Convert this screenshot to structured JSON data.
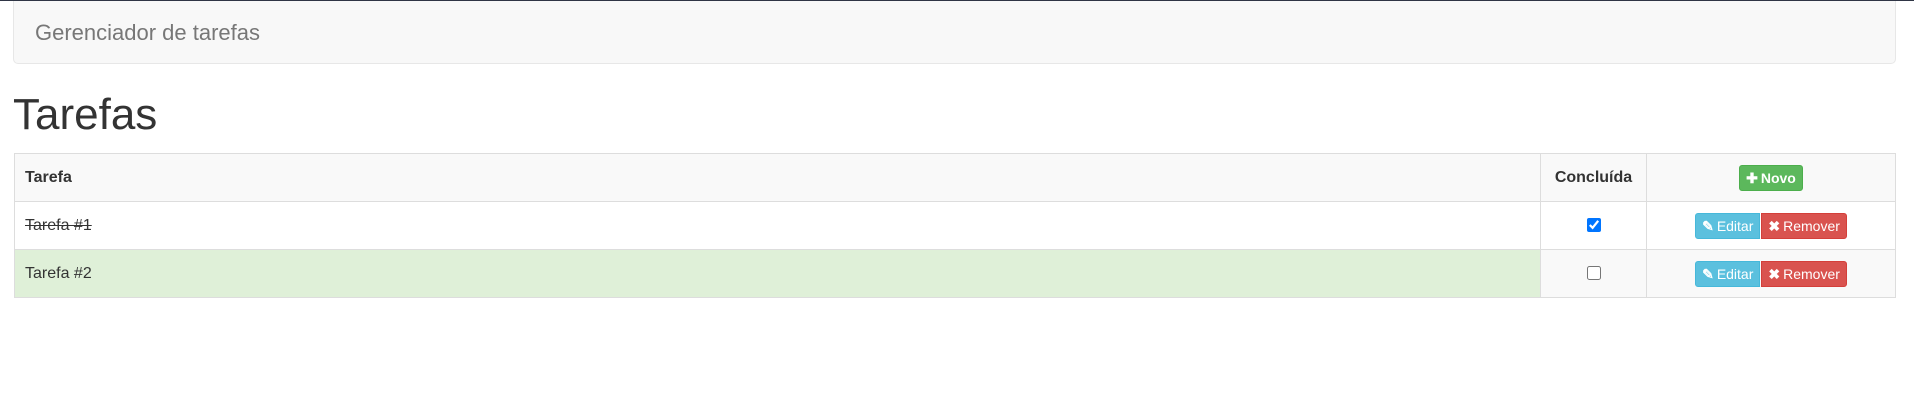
{
  "navbar": {
    "brand": "Gerenciador de tarefas"
  },
  "page": {
    "title": "Tarefas"
  },
  "table": {
    "headers": {
      "task": "Tarefa",
      "done": "Concluída"
    },
    "new_button": {
      "icon": "plus-icon",
      "icon_glyph": "✚",
      "label": "Novo"
    },
    "rows": [
      {
        "name": "Tarefa #1",
        "done": true,
        "edit_label": "Editar",
        "remove_label": "Remover"
      },
      {
        "name": "Tarefa #2",
        "done": false,
        "edit_label": "Editar",
        "remove_label": "Remover"
      }
    ],
    "edit_icon": "pencil-icon",
    "edit_glyph": "✎",
    "remove_icon": "x-icon",
    "remove_glyph": "✖"
  },
  "colors": {
    "success": "#5cb85c",
    "info": "#5bc0de",
    "danger": "#d9534f",
    "highlight_row": "#dff0d8"
  }
}
